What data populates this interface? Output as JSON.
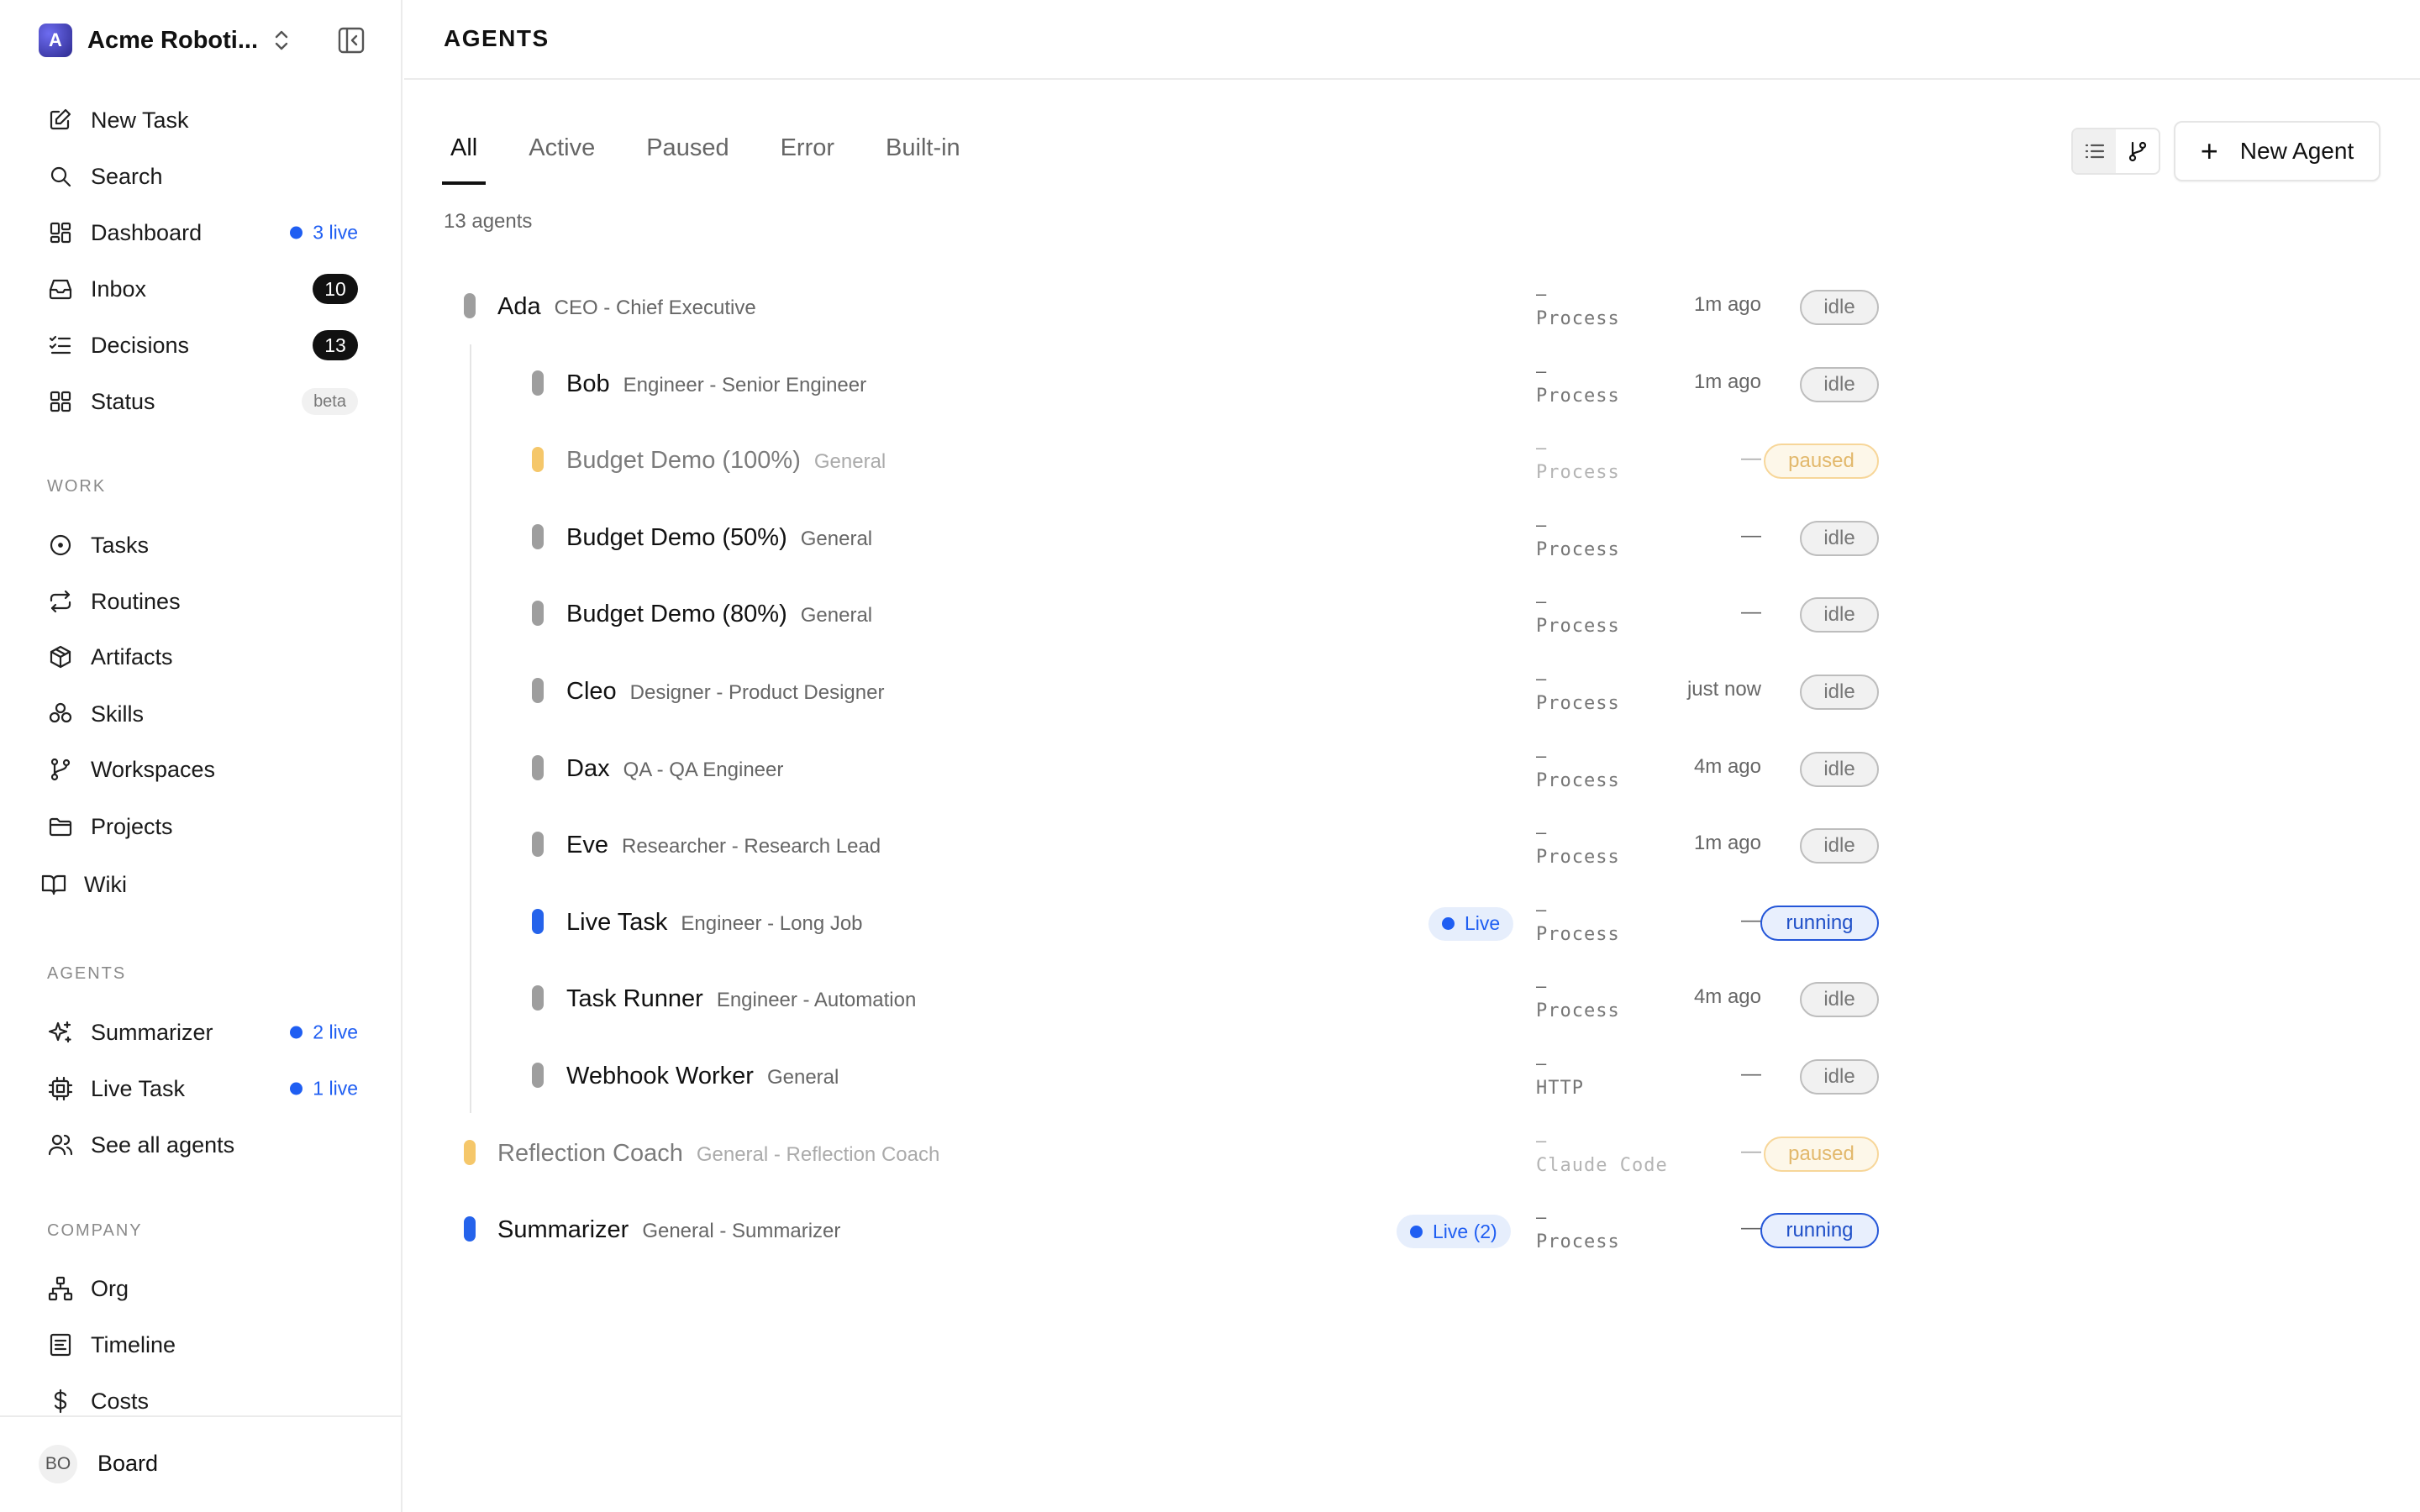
{
  "company": {
    "initial": "A",
    "name": "Acme Roboti..."
  },
  "nav_main": [
    {
      "label": "New Task",
      "icon": "pencil-square-icon"
    },
    {
      "label": "Search",
      "icon": "search-icon"
    },
    {
      "label": "Dashboard",
      "icon": "dashboard-icon",
      "live": "3 live"
    },
    {
      "label": "Inbox",
      "icon": "inbox-icon",
      "count": "10"
    },
    {
      "label": "Decisions",
      "icon": "checklist-icon",
      "count": "13"
    },
    {
      "label": "Status",
      "icon": "grid-icon",
      "badge": "beta"
    }
  ],
  "sections": {
    "work": "WORK",
    "agents": "AGENTS",
    "company": "COMPANY"
  },
  "nav_work": [
    {
      "label": "Tasks",
      "icon": "circle-dot-icon"
    },
    {
      "label": "Routines",
      "icon": "repeat-icon"
    },
    {
      "label": "Artifacts",
      "icon": "box-icon"
    },
    {
      "label": "Skills",
      "icon": "boxes-icon"
    },
    {
      "label": "Workspaces",
      "icon": "git-branch-icon"
    },
    {
      "label": "Projects",
      "icon": "folder-icon"
    },
    {
      "label": "Wiki",
      "icon": "book-icon"
    }
  ],
  "nav_agents": [
    {
      "label": "Summarizer",
      "icon": "sparkles-icon",
      "live": "2 live"
    },
    {
      "label": "Live Task",
      "icon": "cpu-icon",
      "live": "1 live"
    },
    {
      "label": "See all agents",
      "icon": "users-icon"
    }
  ],
  "nav_company": [
    {
      "label": "Org",
      "icon": "org-chart-icon"
    },
    {
      "label": "Timeline",
      "icon": "timeline-icon"
    },
    {
      "label": "Costs",
      "icon": "dollar-icon"
    }
  ],
  "footer": {
    "initials": "BO",
    "name": "Board"
  },
  "header": {
    "title": "AGENTS"
  },
  "tabs": [
    "All",
    "Active",
    "Paused",
    "Error",
    "Built-in"
  ],
  "active_tab": "All",
  "new_agent_label": "New Agent",
  "agents_count": "13 agents",
  "colors": {
    "idle": "#9e9e9e",
    "paused": "#f5c76a",
    "running": "#2563eb"
  },
  "agents": [
    {
      "name": "Ada",
      "role": "CEO - Chief Executive",
      "dash": "–",
      "adapter": "Process",
      "time": "1m ago",
      "status": "idle",
      "depth": 0
    },
    {
      "name": "Bob",
      "role": "Engineer - Senior Engineer",
      "dash": "–",
      "adapter": "Process",
      "time": "1m ago",
      "status": "idle",
      "depth": 1
    },
    {
      "name": "Budget Demo (100%)",
      "role": "General",
      "dash": "–",
      "adapter": "Process",
      "time": "—",
      "status": "paused",
      "depth": 1
    },
    {
      "name": "Budget Demo (50%)",
      "role": "General",
      "dash": "–",
      "adapter": "Process",
      "time": "—",
      "status": "idle",
      "depth": 1
    },
    {
      "name": "Budget Demo (80%)",
      "role": "General",
      "dash": "–",
      "adapter": "Process",
      "time": "—",
      "status": "idle",
      "depth": 1
    },
    {
      "name": "Cleo",
      "role": "Designer - Product Designer",
      "dash": "–",
      "adapter": "Process",
      "time": "just now",
      "status": "idle",
      "depth": 1
    },
    {
      "name": "Dax",
      "role": "QA - QA Engineer",
      "dash": "–",
      "adapter": "Process",
      "time": "4m ago",
      "status": "idle",
      "depth": 1
    },
    {
      "name": "Eve",
      "role": "Researcher - Research Lead",
      "dash": "–",
      "adapter": "Process",
      "time": "1m ago",
      "status": "idle",
      "depth": 1
    },
    {
      "name": "Live Task",
      "role": "Engineer - Long Job",
      "dash": "–",
      "adapter": "Process",
      "time": "—",
      "status": "running",
      "depth": 1,
      "live": "Live"
    },
    {
      "name": "Task Runner",
      "role": "Engineer - Automation",
      "dash": "–",
      "adapter": "Process",
      "time": "4m ago",
      "status": "idle",
      "depth": 1
    },
    {
      "name": "Webhook Worker",
      "role": "General",
      "dash": "–",
      "adapter": "HTTP",
      "time": "—",
      "status": "idle",
      "depth": 1
    },
    {
      "name": "Reflection Coach",
      "role": "General - Reflection Coach",
      "dash": "–",
      "adapter": "Claude Code",
      "time": "—",
      "status": "paused",
      "depth": 0
    },
    {
      "name": "Summarizer",
      "role": "General - Summarizer",
      "dash": "–",
      "adapter": "Process",
      "time": "—",
      "status": "running",
      "depth": 0,
      "live": "Live (2)"
    }
  ]
}
